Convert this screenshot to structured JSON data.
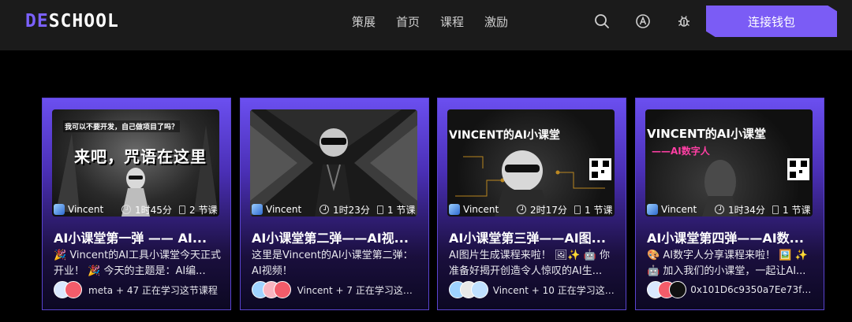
{
  "header": {
    "logo": {
      "first": "DE",
      "rest": "SCHOOL"
    },
    "nav": [
      "策展",
      "首页",
      "课程",
      "激励"
    ],
    "icons": [
      "search-icon",
      "translate-icon",
      "bug-icon"
    ],
    "connect_label": "连接钱包"
  },
  "colors": {
    "accent": "#7b5cf5",
    "topbar": "#1b1b1b",
    "background": "#000000"
  },
  "cards": [
    {
      "thumb_top": "我可以不要开发，自己做项目了吗？",
      "thumb_main": "来吧，咒语在这里",
      "author": "Vincent",
      "duration": "1时45分",
      "sections": "2 节课",
      "title": "AI小课堂第一弹 —— AI...",
      "desc": "🎉 Vincent的AI工具小课堂今天正式开业！ 🎉 今天的主题是：AI编...",
      "learners": "meta + 47 正在学习这节课程"
    },
    {
      "thumb_top": "",
      "thumb_main": "",
      "author": "Vincent",
      "duration": "1时23分",
      "sections": "1 节课",
      "title": "AI小课堂第二弹——AI视...",
      "desc": "这里是Vincent的AI小课堂第二弹：AI视频！",
      "learners": "Vincent + 7 正在学习这节..."
    },
    {
      "thumb_top": "VINCENT的AI小课堂",
      "thumb_main": "",
      "author": "Vincent",
      "duration": "2时17分",
      "sections": "1 节课",
      "title": "AI小课堂第三弹——AI图...",
      "desc": "AI图片生成课程来啦！ 🖼✨ 🤖 你准备好揭开创造令人惊叹的AI生...",
      "learners": "Vincent + 10 正在学习这节..."
    },
    {
      "thumb_top": "VINCENT的AI小课堂",
      "thumb_main": "——AI数字人",
      "author": "Vincent",
      "duration": "1时34分",
      "sections": "1 节课",
      "title": "AI小课堂第四弹——AI数...",
      "desc": "🎨 AI数字人分享课程来啦！ 🖼️ ✨ 🤖 加入我们的小课堂，一起让AI...",
      "learners": "0x101D6c9350a7Ee73f73..."
    }
  ]
}
